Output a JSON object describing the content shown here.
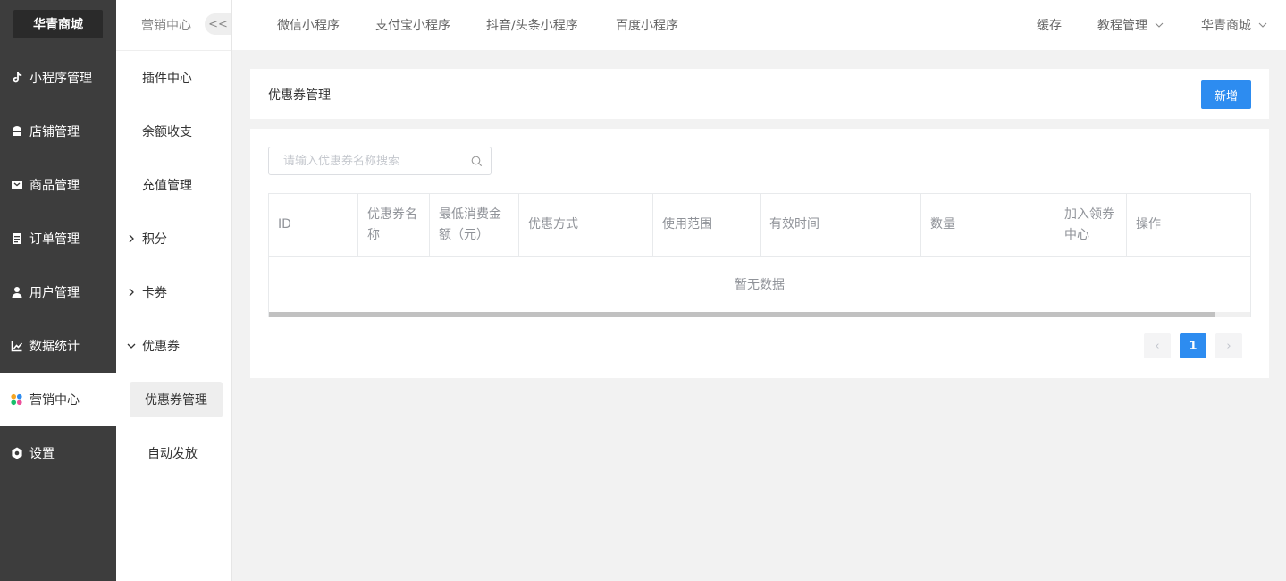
{
  "app": {
    "logo": "华青商城"
  },
  "sidebar": {
    "items": [
      {
        "label": "小程序管理",
        "icon": "tiktok-icon"
      },
      {
        "label": "店铺管理",
        "icon": "store-icon"
      },
      {
        "label": "商品管理",
        "icon": "goods-icon"
      },
      {
        "label": "订单管理",
        "icon": "order-icon"
      },
      {
        "label": "用户管理",
        "icon": "user-icon"
      },
      {
        "label": "数据统计",
        "icon": "chart-icon"
      },
      {
        "label": "营销中心",
        "icon": "marketing-icon",
        "active": true
      },
      {
        "label": "设置",
        "icon": "gear-icon"
      }
    ]
  },
  "subnav": {
    "title": "营销中心",
    "collapse_label": "<<",
    "items": [
      {
        "label": "插件中心"
      },
      {
        "label": "余额收支"
      },
      {
        "label": "充值管理"
      },
      {
        "label": "积分",
        "expandable": true,
        "expanded": false
      },
      {
        "label": "卡券",
        "expandable": true,
        "expanded": false
      },
      {
        "label": "优惠券",
        "expandable": true,
        "expanded": true
      },
      {
        "label": "优惠券管理",
        "child": true,
        "selected": true
      },
      {
        "label": "自动发放",
        "child": true
      }
    ]
  },
  "topbar": {
    "tabs": [
      "微信小程序",
      "支付宝小程序",
      "抖音/头条小程序",
      "百度小程序"
    ],
    "cache_label": "缓存",
    "tutorial_label": "教程管理",
    "store_label": "华青商城"
  },
  "page": {
    "title": "优惠券管理",
    "add_label": "新增"
  },
  "search": {
    "placeholder": "请输入优惠券名称搜索",
    "value": ""
  },
  "table": {
    "columns": [
      "ID",
      "优惠券名称",
      "最低消费金额（元）",
      "优惠方式",
      "使用范围",
      "有效时间",
      "数量",
      "加入领券中心",
      "操作"
    ],
    "empty_text": "暂无数据",
    "rows": []
  },
  "pagination": {
    "current": "1",
    "prev": "‹",
    "next": "›"
  },
  "colors": {
    "primary": "#2d8cf0",
    "sidebar_bg": "#3d3d3d",
    "logo_bg": "#2a2a2a"
  }
}
